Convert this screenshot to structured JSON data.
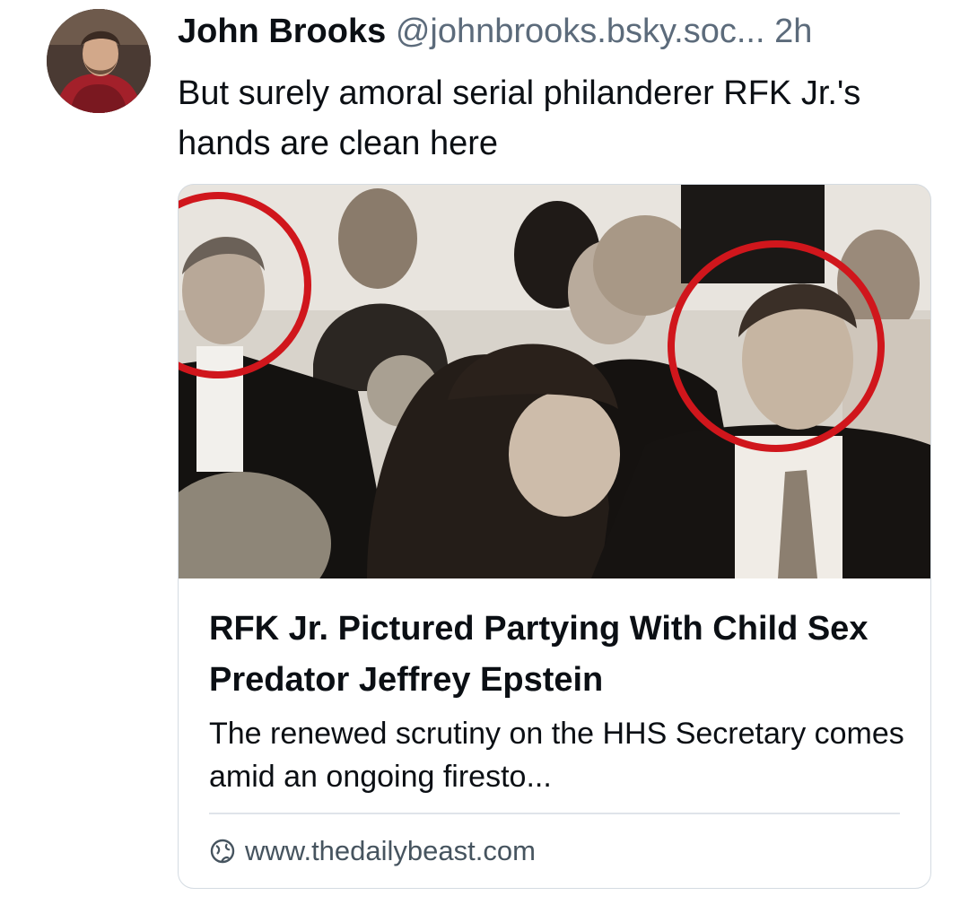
{
  "post": {
    "author_name": "John Brooks",
    "author_handle": "@johnbrooks.bsky.soc...",
    "time": "2h",
    "text": "But surely amoral serial philanderer RFK Jr.'s hands are clean here"
  },
  "link_card": {
    "title": "RFK Jr. Pictured Partying With Child Sex Predator Jeffrey Epstein",
    "description": "The renewed scrutiny on the HHS Secretary comes amid an ongoing firesto...",
    "domain": "www.thedailybeast.com",
    "domain_icon": "globe-icon"
  },
  "colors": {
    "muted_text": "#5c6b7b",
    "card_border": "#d4dbe2",
    "highlight_circle": "#d0161c"
  }
}
